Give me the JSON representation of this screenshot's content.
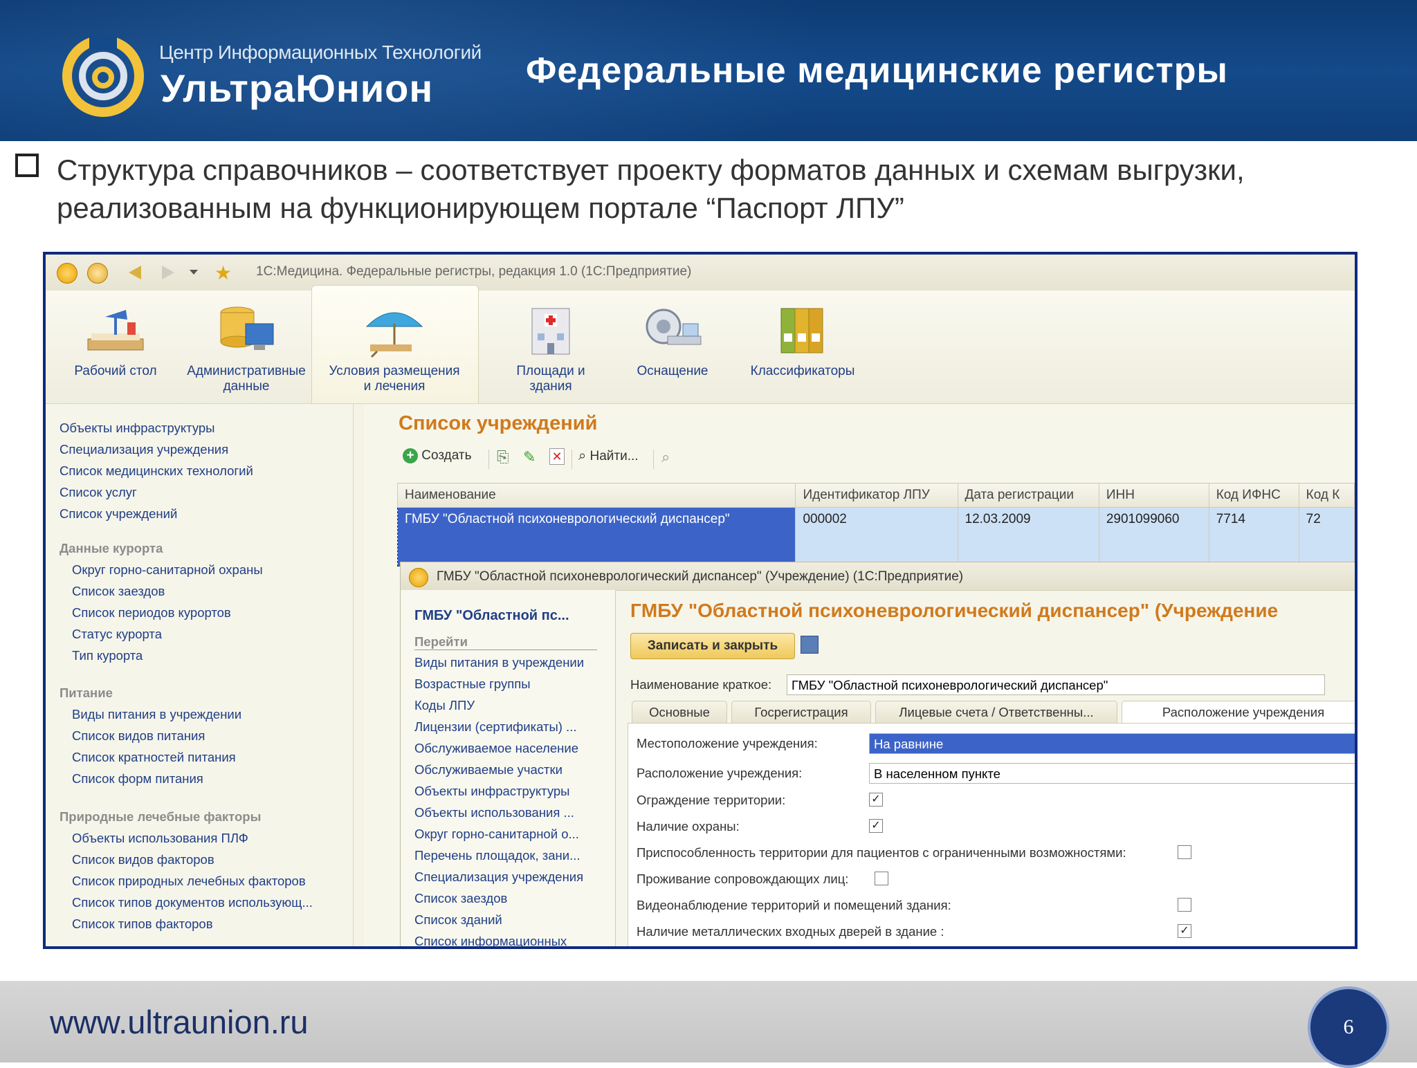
{
  "header": {
    "logo_line1": "Центр Информационных Технологий",
    "logo_line2": "УльтраЮнион",
    "title": "Федеральные медицинские регистры"
  },
  "bullet": {
    "text": "Структура справочников – соответствует проекту форматов данных и схемам выгрузки, реализованным на функционирующем портале “Паспорт ЛПУ”"
  },
  "app": {
    "window_title": "1С:Медицина. Федеральные регистры, редакция 1.0  (1С:Предприятие)",
    "ribbon": [
      {
        "label": "Рабочий стол",
        "icon": "desk-lamp-icon"
      },
      {
        "label": "Административные данные",
        "icon": "database-computer-icon"
      },
      {
        "label": "Условия размещения и лечения",
        "icon": "beach-umbrella-icon"
      },
      {
        "label": "Площади и здания",
        "icon": "hospital-building-icon"
      },
      {
        "label": "Оснащение",
        "icon": "medical-scanner-icon"
      },
      {
        "label": "Классификаторы",
        "icon": "binders-icon"
      }
    ],
    "nav": {
      "group1": [
        "Объекты инфраструктуры",
        "Специализация учреждения",
        "Список медицинских технологий",
        "Список услуг",
        "Список учреждений"
      ],
      "group2_title": "Данные курорта",
      "group2": [
        "Округ горно-санитарной охраны",
        "Список заездов",
        "Список периодов курортов",
        "Статус курорта",
        "Тип курорта"
      ],
      "group3_title": "Питание",
      "group3": [
        "Виды питания в учреждении",
        "Список видов питания",
        "Список кратностей питания",
        "Список форм питания"
      ],
      "group4_title": "Природные лечебные факторы",
      "group4": [
        "Объекты использования ПЛФ",
        "Список видов факторов",
        "Список природных лечебных факторов",
        "Список типов документов использующ...",
        "Список типов факторов"
      ]
    },
    "list": {
      "title": "Список учреждений",
      "toolbar": {
        "create": "Создать",
        "find": "Найти..."
      },
      "columns": [
        "Наименование",
        "Идентификатор ЛПУ",
        "Дата регистрации",
        "ИНН",
        "Код ИФНС",
        "Код К"
      ],
      "row": [
        "ГМБУ \"Областной психоневрологический диспансер\"",
        "000002",
        "12.03.2009",
        "2901099060",
        "7714",
        "72"
      ]
    },
    "sub": {
      "window_title": "ГМБУ \"Областной психоневрологический диспансер\" (Учреждение)  (1С:Предприятие)",
      "left_title": "ГМБУ \"Областной пс...",
      "left_section": "Перейти",
      "left_items": [
        "Виды питания в учреждении",
        "Возрастные группы",
        "Коды ЛПУ",
        "Лицензии (сертификаты) ...",
        "Обслуживаемое население",
        "Обслуживаемые участки",
        "Объекты инфраструктуры",
        "Объекты использования ...",
        "Округ горно-санитарной о...",
        "Перечень площадок, зани...",
        "Специализация учреждения",
        "Список заездов",
        "Список зданий",
        "Список информационных"
      ],
      "heading": "ГМБУ \"Областной психоневрологический диспансер\" (Учреждение",
      "save_button": "Записать и закрыть",
      "short_name_label": "Наименование краткое:",
      "short_name_value": "ГМБУ \"Областной психоневрологический диспансер\"",
      "tabs": [
        "Основные",
        "Госрегистрация",
        "Лицевые счета / Ответственны...",
        "Расположение учреждения"
      ],
      "fields": {
        "location_label": "Местоположение учреждения:",
        "location_value": "На равнине",
        "placement_label": "Расположение учреждения:",
        "placement_value": "В населенном пункте"
      },
      "checks": [
        {
          "label": "Ограждение территории:",
          "checked": true
        },
        {
          "label": "Наличие охраны:",
          "checked": true
        },
        {
          "label": "Приспособленность территории для пациентов с ограниченными возможностями:",
          "checked": false
        },
        {
          "label": "Проживание сопровождающих лиц:",
          "checked": false
        },
        {
          "label": "Видеонаблюдение территорий и помещений здания:",
          "checked": false
        },
        {
          "label": "Наличие металлических входных дверей в здание  :",
          "checked": true
        }
      ]
    }
  },
  "footer": {
    "site": "www.ultraunion.ru",
    "page": "6"
  }
}
